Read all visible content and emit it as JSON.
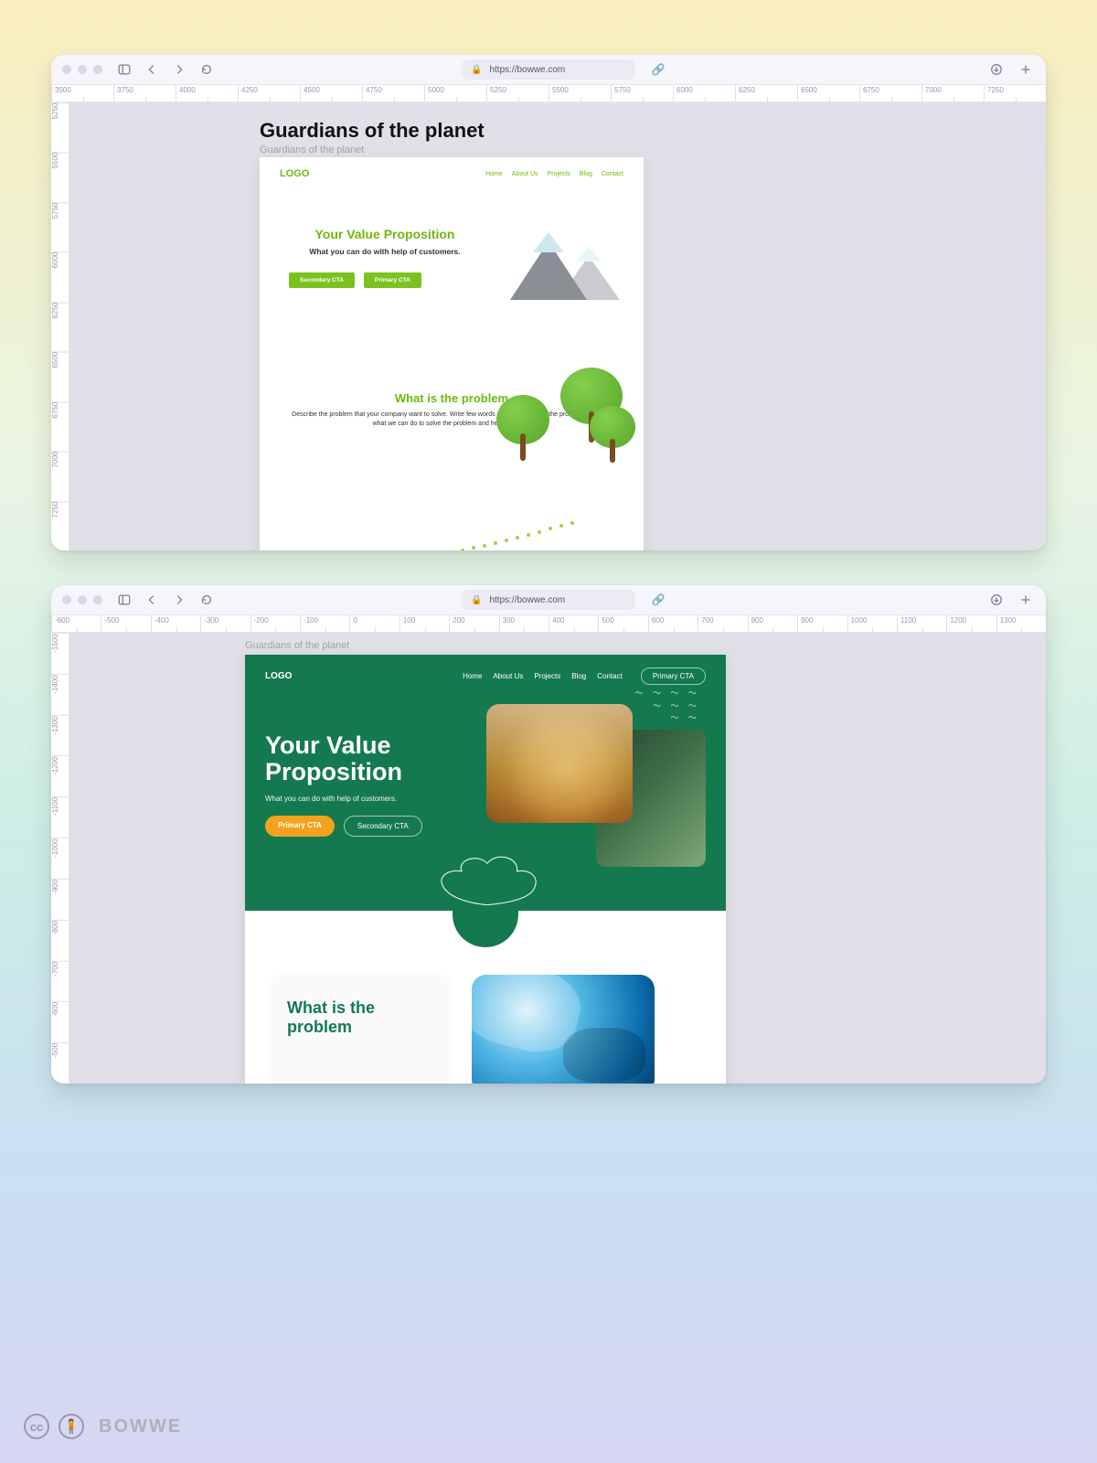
{
  "browser": {
    "url": "https://bowwe.com",
    "icons": {
      "sidebar": "sidebar-icon",
      "back": "back-icon",
      "forward": "forward-icon",
      "reload": "reload-icon",
      "lock": "lock-icon",
      "link": "link-icon",
      "download": "download-icon",
      "newtab": "plus-icon"
    }
  },
  "window1": {
    "ruler_h": [
      "3500",
      "3750",
      "4000",
      "4250",
      "4500",
      "4750",
      "5000",
      "5250",
      "5500",
      "5750",
      "6000",
      "6250",
      "6500",
      "6750",
      "7000",
      "7250"
    ],
    "ruler_v": [
      "5250",
      "5500",
      "5750",
      "6000",
      "6250",
      "6500",
      "6750",
      "7000",
      "7250"
    ],
    "title": "Guardians of the planet",
    "subtitle": "Guardians of the planet",
    "page": {
      "logo": "LOGO",
      "nav": [
        "Home",
        "About Us",
        "Projects",
        "Blog",
        "Contact"
      ],
      "hero_headline": "Your Value Proposition",
      "hero_sub": "What you can do with help of customers.",
      "btn_secondary": "Secondary CTA",
      "btn_primary": "Primary CTA",
      "sec2_headline": "What is the problem",
      "sec2_body": "Describe the problem that your company want to solve. Write few words about what cause the problem. Describe what we can do to solve the problem and help to stop it."
    }
  },
  "window2": {
    "ruler_h": [
      "-600",
      "-500",
      "-400",
      "-300",
      "-200",
      "-100",
      "0",
      "100",
      "200",
      "300",
      "400",
      "500",
      "600",
      "700",
      "800",
      "900",
      "1000",
      "1100",
      "1200",
      "1300"
    ],
    "ruler_v": [
      "-1500",
      "-1400",
      "-1300",
      "-1200",
      "-1100",
      "-1000",
      "-900",
      "-800",
      "-700",
      "-600",
      "-500"
    ],
    "subtitle": "Guardians of the planet",
    "page": {
      "logo": "LOGO",
      "nav": [
        "Home",
        "About Us",
        "Projects",
        "Blog",
        "Contact"
      ],
      "header_cta": "Primary CTA",
      "hero_headline": "Your Value Proposition",
      "hero_sub": "What you can do with help of customers.",
      "btn_primary": "Primary CTA",
      "btn_secondary": "Secondary CTA",
      "sec2_headline": "What is the problem"
    }
  },
  "footer": {
    "cc": "cc",
    "by": "BY",
    "brand": "BOWWE"
  },
  "colors": {
    "green_light": "#7bc21f",
    "green_dark": "#14794f",
    "orange": "#f2a21c"
  }
}
